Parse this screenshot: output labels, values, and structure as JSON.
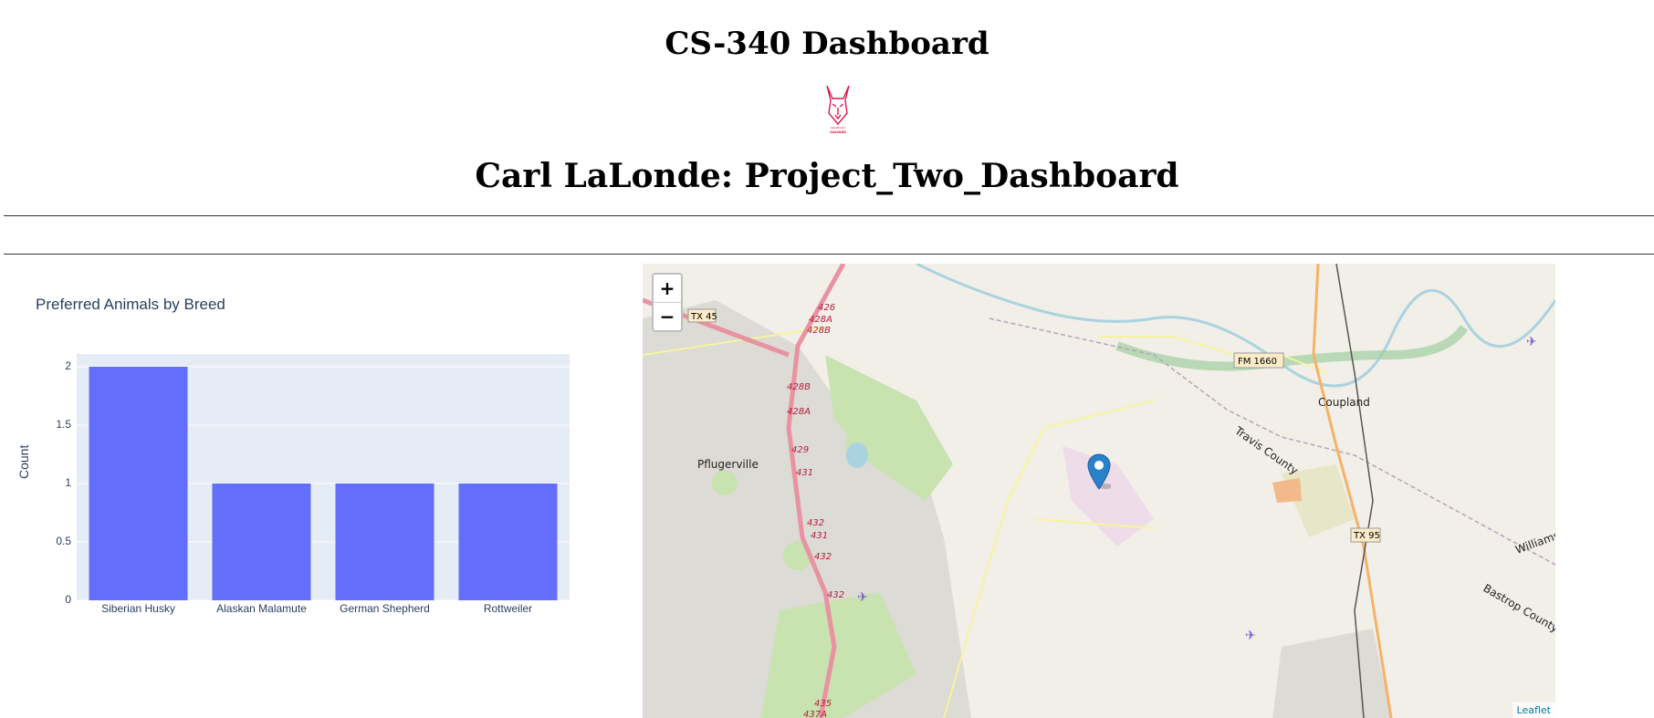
{
  "page": {
    "title": "CS-340 Dashboard",
    "subtitle": "Carl LaLonde: Project_Two_Dashboard",
    "logo_text": "GRAZIOSO SALVARE"
  },
  "chart_data": {
    "type": "bar",
    "title": "Preferred Animals by Breed",
    "xlabel": "",
    "ylabel": "Count",
    "categories": [
      "Siberian Husky",
      "Alaskan Malamute",
      "German Shepherd",
      "Rottweiler"
    ],
    "values": [
      2,
      1,
      1,
      1
    ],
    "ylim": [
      0,
      2
    ],
    "yticks": [
      "0",
      "0.5",
      "1",
      "1.5",
      "2"
    ],
    "bar_color": "#636efa",
    "plot_bg": "#e5ecf6",
    "grid": true
  },
  "map": {
    "zoom_in": "+",
    "zoom_out": "−",
    "attribution": "Leaflet",
    "places": {
      "pflugerville": "Pflugerville",
      "coupland": "Coupland",
      "travis_county": "Travis County",
      "bastrop_county": "Bastrop County",
      "williamson": "Williamson"
    },
    "road_labels": {
      "tx45": "TX 45",
      "fm1660": "FM 1660",
      "tx95": "TX 95",
      "e426": "426",
      "e428a_top": "428A",
      "e428b_top": "428B",
      "e428b": "428B",
      "e428a": "428A",
      "e429": "429",
      "e431": "431",
      "e432": "432",
      "e431b": "431",
      "e432b": "432",
      "e432c": "432",
      "e435": "435",
      "e437a": "437A"
    },
    "marker_icon": "map-pin-icon",
    "colors": {
      "marker": "#2a81cb",
      "highway": "#e892a2",
      "river": "#aad3df",
      "park": "#c8e2b0"
    }
  }
}
